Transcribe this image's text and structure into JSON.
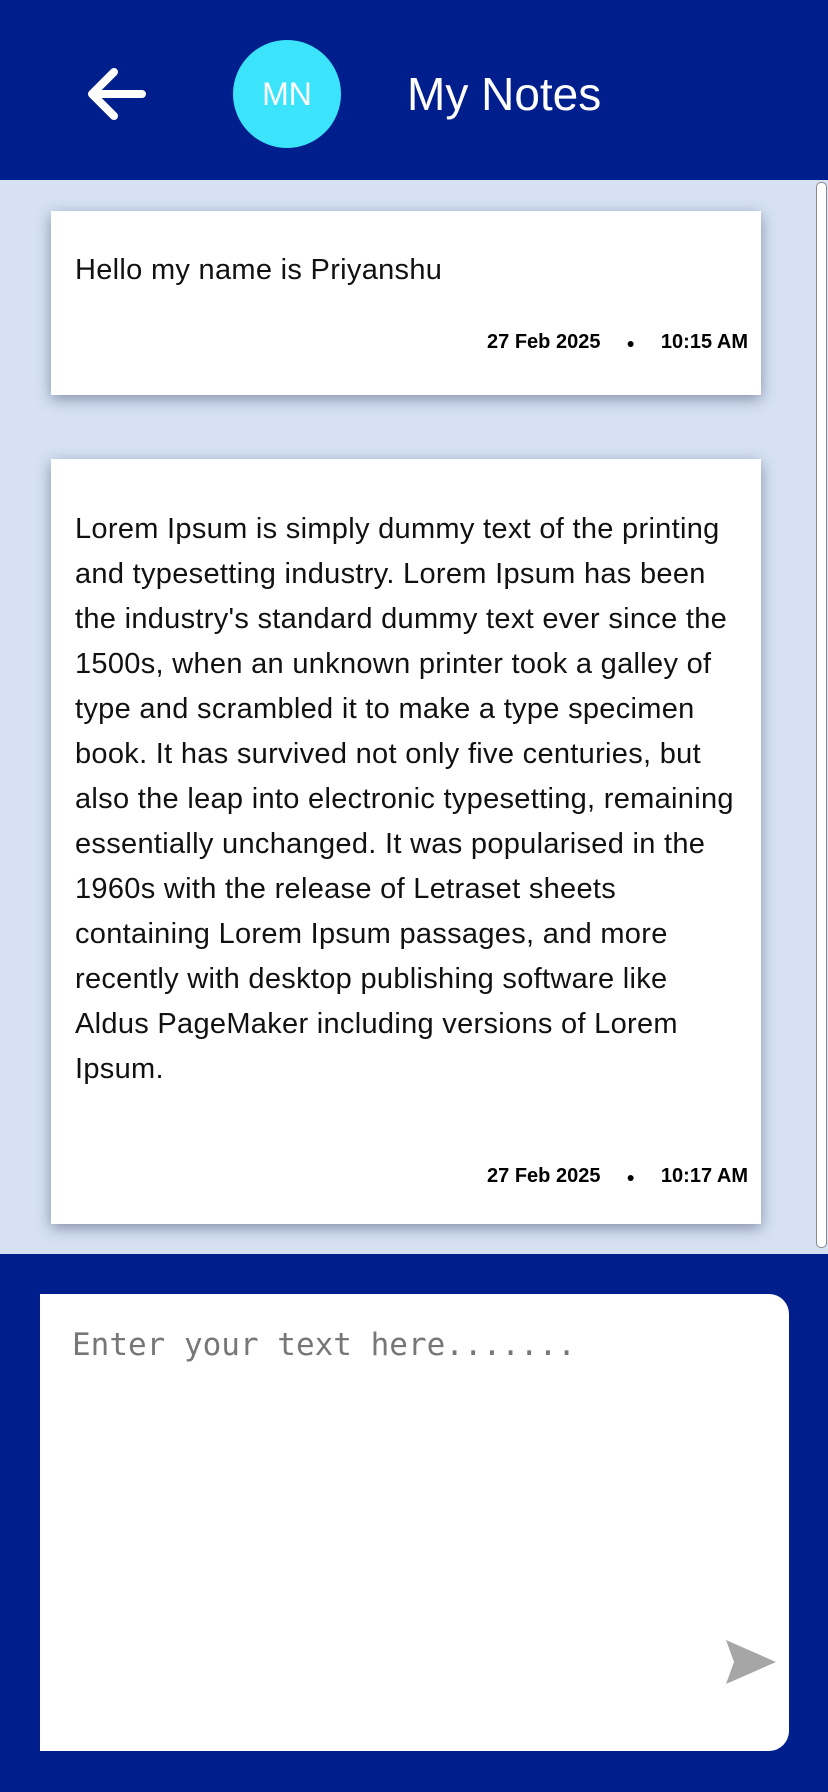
{
  "header": {
    "avatar_initials": "MN",
    "title": "My Notes",
    "back_icon": "arrow-left-icon"
  },
  "notes": [
    {
      "text": "Hello my name is Priyanshu",
      "date": "27 Feb 2025",
      "separator": "●",
      "time": "10:15 AM"
    },
    {
      "text": "Lorem Ipsum is simply dummy text of the printing and typesetting industry. Lorem Ipsum has been the industry's standard dummy text ever since the 1500s, when an unknown printer took a galley of type and scrambled it to make a type specimen book. It has survived not only five centuries, but also the leap into electronic typesetting, remaining essentially unchanged. It was popularised in the 1960s with the release of Letraset sheets containing Lorem Ipsum passages, and more recently with desktop publishing software like Aldus PageMaker including versions of Lorem Ipsum.",
      "date": "27 Feb 2025",
      "separator": "●",
      "time": "10:17 AM"
    }
  ],
  "composer": {
    "placeholder": "Enter your text here.......",
    "value": "",
    "send_icon": "send-icon"
  },
  "colors": {
    "primary": "#001e8c",
    "avatar": "#3be4fb",
    "notes_background": "#d6e2f4",
    "card": "#ffffff",
    "send_icon": "#a6a6a6"
  }
}
